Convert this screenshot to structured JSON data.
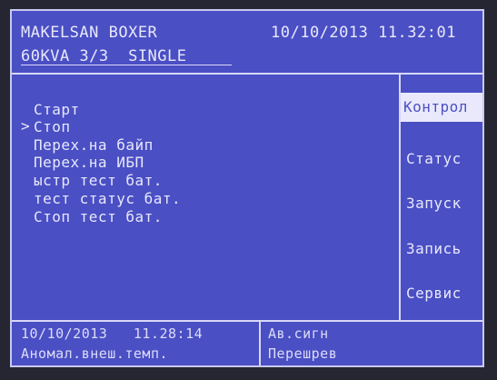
{
  "header": {
    "model": "MAKELSAN BOXER",
    "config": "60KVA 3/3  SINGLE",
    "datetime": "10/10/2013 11.32:01"
  },
  "menu": {
    "cursor": ">",
    "items": [
      "Старт",
      "Стоп",
      "Перех.на байп",
      "Перех.на ИБП",
      "ыстр тест бат.",
      "тест статус бат.",
      "Стоп тест бат."
    ],
    "selected_index": 1
  },
  "side_menu": {
    "items": [
      "Контрол",
      "Статус",
      "Запуск",
      "Запись",
      "Сервис"
    ],
    "active_index": 0
  },
  "footer": {
    "left_datetime": "10/10/2013   11.28:14",
    "left_event": "Аномал.внеш.темп.",
    "right_title": "Ав.сигн",
    "right_event": "Перешрев"
  },
  "colors": {
    "screen": "#4a4fc4",
    "text": "#e8e8fb",
    "highlight_bg": "#e9e9fb"
  }
}
